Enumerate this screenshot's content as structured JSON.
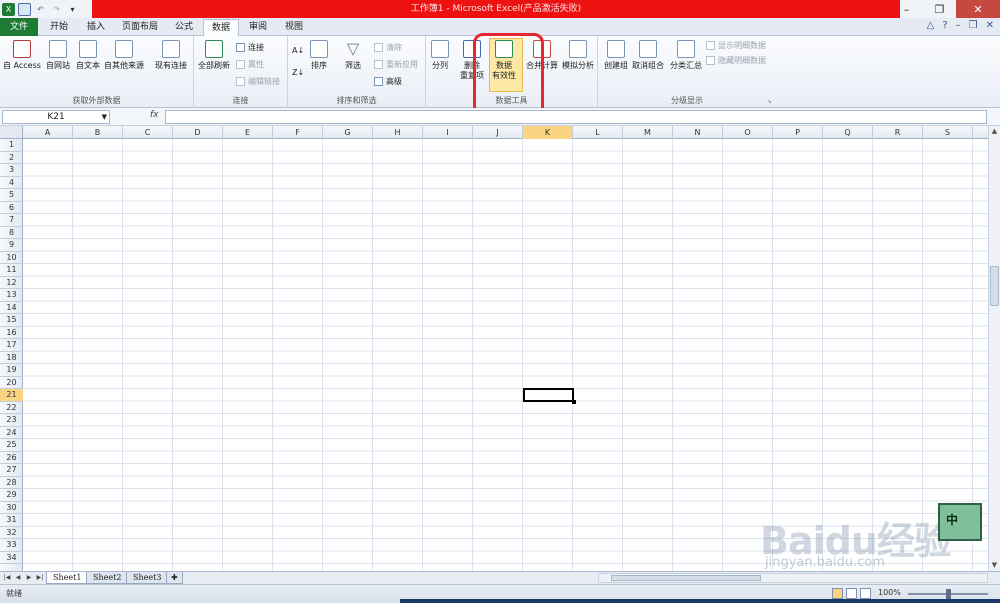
{
  "window": {
    "title": "工作簿1 - Microsoft Excel(产品激活失败)"
  },
  "tabs": [
    "文件",
    "开始",
    "插入",
    "页面布局",
    "公式",
    "数据",
    "审阅",
    "视图"
  ],
  "ribbon": {
    "get_external": {
      "label": "获取外部数据",
      "buttons": [
        "自 Access",
        "自网站",
        "自文本",
        "自其他来源",
        "现有连接"
      ]
    },
    "connections": {
      "label": "连接",
      "refresh": "全部刷新",
      "items": [
        "连接",
        "属性",
        "编辑链接"
      ]
    },
    "sort_filter": {
      "label": "排序和筛选",
      "sort": "排序",
      "filter": "筛选",
      "items": [
        "清除",
        "重新应用",
        "高级"
      ]
    },
    "data_tools": {
      "label": "数据工具",
      "split": "分列",
      "remove_dup_1": "删除",
      "remove_dup_2": "重复项",
      "validation_1": "数据",
      "validation_2": "有效性",
      "consolidate": "合并计算",
      "whatif": "模拟分析"
    },
    "outline": {
      "label": "分级显示",
      "group": "创建组",
      "ungroup": "取消组合",
      "subtotal": "分类汇总",
      "items": [
        "显示明细数据",
        "隐藏明细数据"
      ]
    }
  },
  "formula_bar": {
    "name_box": "K21",
    "fx": "fx",
    "content": ""
  },
  "columns": [
    "A",
    "B",
    "C",
    "D",
    "E",
    "F",
    "G",
    "H",
    "I",
    "J",
    "K",
    "L",
    "M",
    "N",
    "O",
    "P",
    "Q",
    "R",
    "S"
  ],
  "selected_column": "K",
  "rows": [
    "1",
    "2",
    "3",
    "4",
    "5",
    "6",
    "7",
    "8",
    "9",
    "10",
    "11",
    "12",
    "13",
    "14",
    "15",
    "16",
    "17",
    "18",
    "19",
    "20",
    "21",
    "22",
    "23",
    "24",
    "25",
    "26",
    "27",
    "28",
    "29",
    "30",
    "31",
    "32",
    "33",
    "34"
  ],
  "selected_row": "21",
  "sheets": [
    "Sheet1",
    "Sheet2",
    "Sheet3"
  ],
  "status": {
    "ready": "就绪",
    "zoom": "100%"
  },
  "ime": {
    "label": "中"
  },
  "watermark": {
    "main": "Baidu经验",
    "sub": "jingyan.baidu.com"
  },
  "colors": {
    "title_red": "#ee1111",
    "file_tab": "#1e7b34",
    "highlight_box": "#e8262f",
    "selected_header": "#f9d581"
  }
}
